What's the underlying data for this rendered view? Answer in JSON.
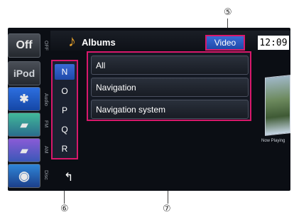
{
  "callouts": {
    "c5": "⑤",
    "c6": "⑥",
    "c7": "⑦"
  },
  "sources": {
    "off": "Off",
    "ipod": "iPod"
  },
  "vertical_labels": [
    "OFF",
    "Audio",
    "FM",
    "AM",
    "Disc"
  ],
  "header": {
    "title": "Albums",
    "video": "Video",
    "clock": "12:09"
  },
  "alphabet": [
    "N",
    "O",
    "P",
    "Q",
    "R"
  ],
  "list": [
    "All",
    "Navigation",
    "Navigation system"
  ],
  "now_playing": "Now Playing",
  "back_symbol": "↰",
  "colors": {
    "highlight": "#d8186b",
    "accent": "#2b5bd0"
  }
}
